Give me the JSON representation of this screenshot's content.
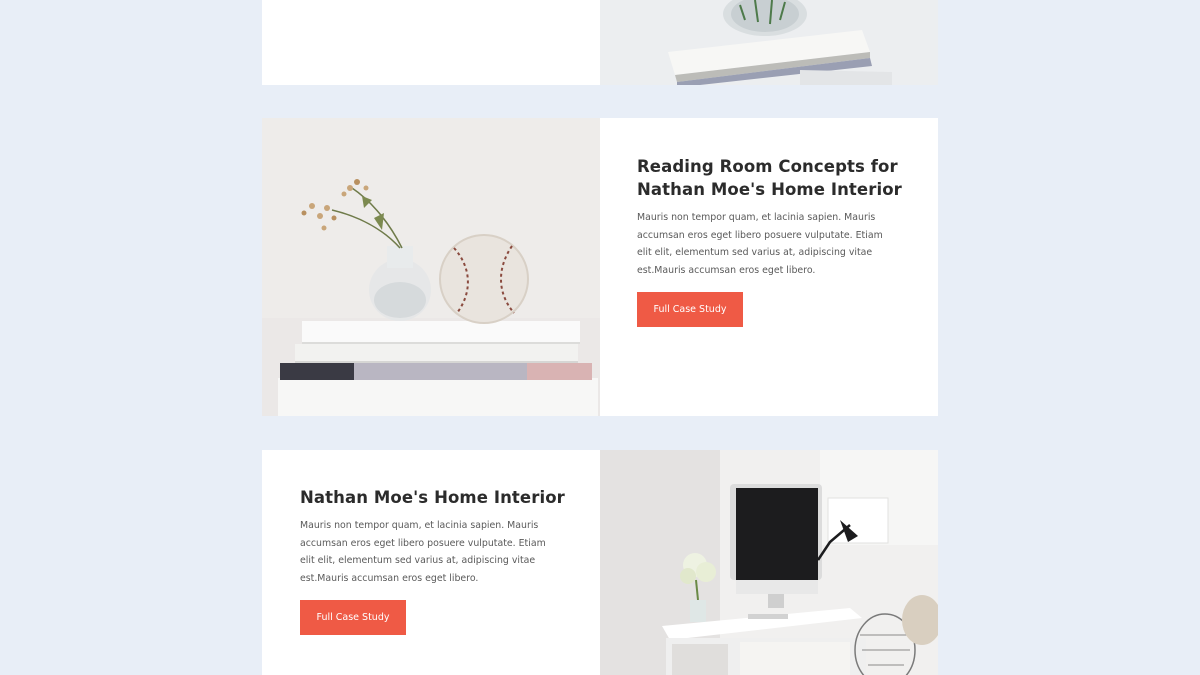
{
  "cards": [
    {
      "title_line1": "Reading Room Concepts for",
      "title_line2": "Nathan Moe's Home Interior",
      "body": "Mauris non tempor quam, et lacinia sapien. Mauris accumsan eros eget libero posuere vulputate. Etiam elit elit, elementum sed varius at, adipiscing vitae est.Mauris accumsan eros eget libero.",
      "button_label": "Full Case Study",
      "image": "vase-and-baseball-on-books-photo"
    },
    {
      "title_line1": "Nathan Moe's Home Interior",
      "body": "Mauris non tempor quam, et lacinia sapien. Mauris accumsan eros eget libero posuere vulputate. Etiam elit elit, elementum sed varius at, adipiscing vitae est.Mauris accumsan eros eget libero.",
      "button_label": "Full Case Study",
      "image": "desk-with-computer-photo"
    }
  ],
  "colors": {
    "page_background": "#e8eef7",
    "button": "#ef5a45",
    "heading": "#2b2b2b",
    "body_text": "#5a5a5a"
  }
}
